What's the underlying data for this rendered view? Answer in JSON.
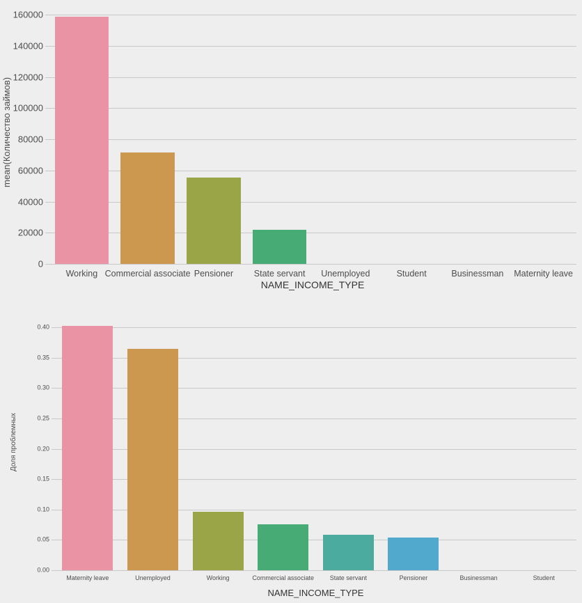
{
  "figure": {
    "background": "#eeeeee",
    "gridline_color": "#c8c8c8"
  },
  "palette": {
    "pink": "#e993a5",
    "orange": "#cc9850",
    "olive": "#99a547",
    "green": "#46ab74",
    "teal": "#4cab9f",
    "blue": "#51a9ce"
  },
  "chart_data": [
    {
      "type": "bar",
      "id": "loans-by-income-type",
      "title": "",
      "xlabel": "NAME_INCOME_TYPE",
      "ylabel": "mean(Количество займов)",
      "ylim": [
        0,
        160000
      ],
      "yticks": [
        0,
        20000,
        40000,
        60000,
        80000,
        100000,
        120000,
        140000,
        160000
      ],
      "ytick_labels": [
        "0",
        "20000",
        "40000",
        "60000",
        "80000",
        "100000",
        "120000",
        "140000",
        "160000"
      ],
      "grid": true,
      "legend": "none",
      "categories": [
        "Working",
        "Commercial associate",
        "Pensioner",
        "State servant",
        "Unemployed",
        "Student",
        "Businessman",
        "Maternity leave"
      ],
      "values": [
        158800,
        71600,
        55400,
        21700,
        0,
        0,
        0,
        0
      ],
      "colors": [
        "#e993a5",
        "#cc9850",
        "#99a547",
        "#46ab74",
        "#4cab9f",
        "#51a9ce",
        "#e993a5",
        "#cc9850"
      ]
    },
    {
      "type": "bar",
      "id": "default-share-by-income-type",
      "title": "",
      "xlabel": "NAME_INCOME_TYPE",
      "ylabel": "Доля проблемных",
      "ylim": [
        0,
        0.4
      ],
      "yticks": [
        0.0,
        0.05,
        0.1,
        0.15,
        0.2,
        0.25,
        0.3,
        0.35,
        0.4
      ],
      "ytick_labels": [
        "0.00",
        "0.05",
        "0.10",
        "0.15",
        "0.20",
        "0.25",
        "0.30",
        "0.35",
        "0.40"
      ],
      "grid": true,
      "legend": "none",
      "categories": [
        "Maternity leave",
        "Unemployed",
        "Working",
        "Commercial associate",
        "State servant",
        "Pensioner",
        "Businessman",
        "Student"
      ],
      "values": [
        0.402,
        0.364,
        0.0958,
        0.0752,
        0.0588,
        0.0536,
        0.0,
        0.0
      ],
      "colors": [
        "#e993a5",
        "#cc9850",
        "#99a547",
        "#46ab74",
        "#4cab9f",
        "#51a9ce",
        "#e993a5",
        "#cc9850"
      ]
    }
  ]
}
